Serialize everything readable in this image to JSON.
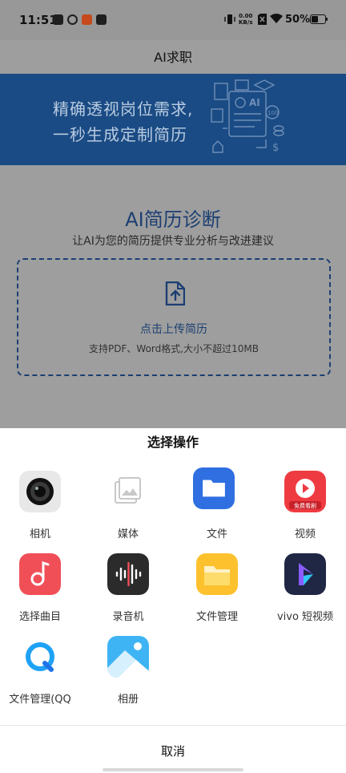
{
  "status_bar": {
    "time": "11:51",
    "net_speed_value": "0.00",
    "net_speed_unit": "KB/s",
    "battery": "50%"
  },
  "app_bar": {
    "title": "AI求职"
  },
  "banner": {
    "line1": "精确透视岗位需求,",
    "line2": "一秒生成定制简历",
    "graphic_text_ai": "AI",
    "graphic_text_score": "100"
  },
  "diagnosis": {
    "title": "AI简历诊断",
    "subtitle": "让AI为您的简历提供专业分析与改进建议",
    "upload_label": "点击上传简历",
    "upload_hint": "支持PDF、Word格式,大小不超过10MB"
  },
  "sheet": {
    "title": "选择操作",
    "apps": [
      {
        "label": "相机",
        "icon": "camera-icon"
      },
      {
        "label": "媒体",
        "icon": "media-gallery-icon"
      },
      {
        "label": "文件",
        "icon": "folder-icon"
      },
      {
        "label": "视频",
        "icon": "video-icon",
        "badge": "免费看剧"
      },
      {
        "label": "选择曲目",
        "icon": "music-note-icon"
      },
      {
        "label": "录音机",
        "icon": "voice-recorder-icon"
      },
      {
        "label": "文件管理",
        "icon": "file-manager-icon"
      },
      {
        "label": "vivo 短视频",
        "icon": "vivo-short-video-icon"
      },
      {
        "label": "文件管理(QQ",
        "icon": "qq-browser-icon"
      },
      {
        "label": "相册",
        "icon": "album-icon"
      }
    ],
    "cancel": "取消"
  },
  "colors": {
    "overlay_bg": "#9e9e9e",
    "banner_bg": "#1a4b84",
    "accent": "#1c3f72",
    "sheet_bg": "#ffffff"
  }
}
